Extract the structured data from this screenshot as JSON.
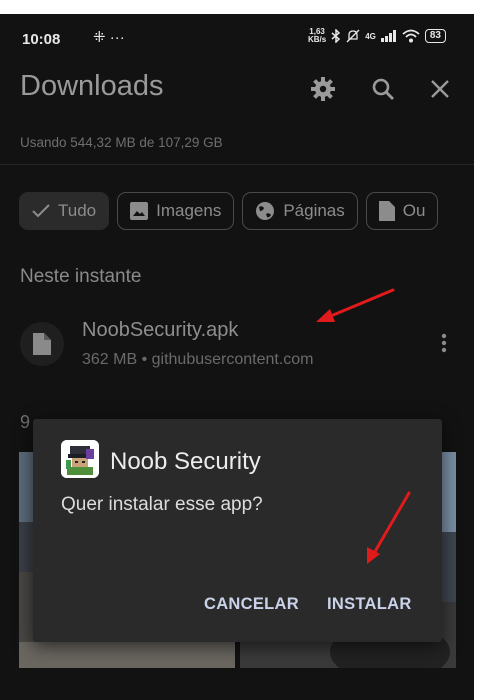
{
  "status_bar": {
    "time": "10:08",
    "notif_glyphs": "⁜ ···",
    "speed_value": "1,63",
    "speed_unit": "KB/s",
    "network": "4G",
    "battery": "83"
  },
  "header": {
    "title": "Downloads",
    "storage_usage": "Usando 544,32 MB de 107,29 GB",
    "actions": [
      "settings-icon",
      "search-icon",
      "close-icon"
    ]
  },
  "filters": [
    {
      "label": "Tudo",
      "icon": "check-icon",
      "selected": true
    },
    {
      "label": "Imagens",
      "icon": "image-icon",
      "selected": false
    },
    {
      "label": "Páginas",
      "icon": "globe-icon",
      "selected": false
    },
    {
      "label": "Ou",
      "icon": "document-icon",
      "selected": false
    }
  ],
  "section_now": "Neste instante",
  "download": {
    "name": "NoobSecurity.apk",
    "meta": "362 MB • githubusercontent.com"
  },
  "date_group_partial": "9",
  "dialog": {
    "app_name": "Noob Security",
    "message": "Quer instalar esse app?",
    "cancel": "CANCELAR",
    "install": "INSTALAR"
  },
  "colors": {
    "background": "#121212",
    "dialog": "#2a2a2a",
    "annotation_arrow": "#e01b1b",
    "dialog_button": "#c9d2e8"
  }
}
